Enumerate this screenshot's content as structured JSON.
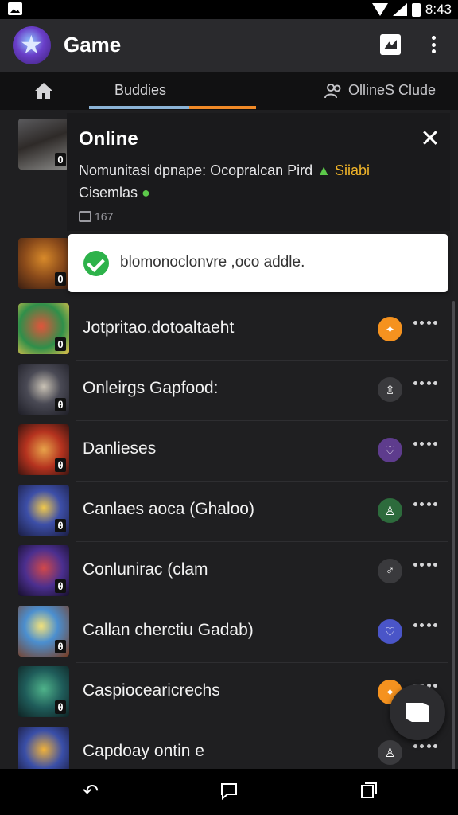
{
  "status_bar": {
    "time": "8:43"
  },
  "app_bar": {
    "title": "Game"
  },
  "tabs": [
    {
      "label": "Buddies"
    },
    {
      "label": "OllineS Clude"
    }
  ],
  "popup": {
    "title": "Online",
    "message_main": "Nomunitasi dpnape: Ocopralcan Pird",
    "message_highlight": "Siiabi",
    "message_line2": "Cisemlas",
    "count": "167"
  },
  "toast": {
    "message": "blomonoclonvre ,oco addle."
  },
  "list": [
    {
      "title": "",
      "badge": "0",
      "status_color": "",
      "status_glyph": ""
    },
    {
      "title": "",
      "badge": "0",
      "status_color": "",
      "status_glyph": ""
    },
    {
      "title": "Jotpritao.dotoaltaeht",
      "badge": "0",
      "status_color": "#f5921f",
      "status_glyph": "✦"
    },
    {
      "title": "Onleirgs Gapfood:",
      "badge": "θ",
      "status_color": "#3a3a3d",
      "status_glyph": "⇫"
    },
    {
      "title": "Danlieses",
      "badge": "θ",
      "status_color": "#5e3c8d",
      "status_glyph": "♡"
    },
    {
      "title": "Canlaes aoca (Ghaloo)",
      "badge": "θ",
      "status_color": "#2d6b3c",
      "status_glyph": "♙"
    },
    {
      "title": "Conlunirac (clam",
      "badge": "θ",
      "status_color": "#3a3a3d",
      "status_glyph": "♂"
    },
    {
      "title": "Callan cherctiu Gadab)",
      "badge": "θ",
      "status_color": "#4a55c8",
      "status_glyph": "♡"
    },
    {
      "title": "Caspiocearicrechs",
      "badge": "θ",
      "status_color": "#f5921f",
      "status_glyph": "✦"
    },
    {
      "title": "Capdoay ontin e",
      "badge": "",
      "status_color": "#3a3a3d",
      "status_glyph": "♙"
    }
  ],
  "icons": {
    "home": "home-icon",
    "friends": "friends-icon",
    "check": "check-icon",
    "close": "close-icon",
    "more": "more-icon",
    "fab": "compose-icon",
    "back": "back-icon",
    "recent": "recent-apps-icon"
  }
}
